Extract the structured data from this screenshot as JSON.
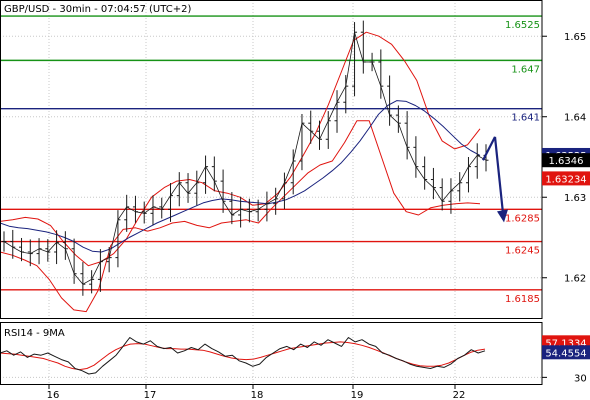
{
  "header": {
    "title": "GBP/USD - 30min - 07:04:57 (UTC+2)"
  },
  "colors": {
    "resistance": "#169216",
    "pivot": "#1a237e",
    "support": "#e0140f",
    "price": "#1a1a1a",
    "bollinger": "#e0140f",
    "moving_average": "#1a237e",
    "forecast_arrow": "#1a237e",
    "rsi_line": "#1a1a1a",
    "rsi_ma": "#e0140f",
    "grid": "#c8c8c8"
  },
  "chart_data": [
    {
      "type": "line",
      "title": "GBP/USD - 30min - 07:04:57 (UTC+2)",
      "x": [
        "16",
        "17",
        "18",
        "19",
        "22"
      ],
      "ylim": [
        1.615,
        1.6545
      ],
      "y_ticks": [
        "1.65",
        "1.64",
        "1.63",
        "1.62"
      ],
      "grid": true,
      "levels": [
        {
          "label": "1.6525",
          "value": 1.6525,
          "role": "resistance"
        },
        {
          "label": "1.647",
          "value": 1.647,
          "role": "resistance"
        },
        {
          "label": "1.641",
          "value": 1.641,
          "role": "pivot"
        },
        {
          "label": "1.6285",
          "value": 1.6285,
          "role": "support"
        },
        {
          "label": "1.6245",
          "value": 1.6245,
          "role": "support"
        },
        {
          "label": "1.6185",
          "value": 1.6185,
          "role": "support"
        }
      ],
      "badges": [
        {
          "label": "1.63525",
          "value": 1.63525,
          "color": "#1a237e"
        },
        {
          "label": "1.6346",
          "value": 1.6346,
          "color": "#000000"
        },
        {
          "label": "1.63234",
          "value": 1.63234,
          "color": "#e0140f"
        }
      ],
      "series": [
        {
          "values": [
            1.6245,
            1.6238,
            1.6232,
            1.623,
            1.6236,
            1.6232,
            1.6244,
            1.6236,
            1.6205,
            1.6192,
            1.6198,
            1.622,
            1.6225,
            1.6272,
            1.6288,
            1.6282,
            1.628,
            1.6288,
            1.6285,
            1.6302,
            1.6318,
            1.6305,
            1.6318,
            1.6338,
            1.632,
            1.6295,
            1.6278,
            1.6285,
            1.6282,
            1.6285,
            1.6292,
            1.6298,
            1.6318,
            1.6345,
            1.6392,
            1.6382,
            1.6372,
            1.6395,
            1.6418,
            1.6438,
            1.6505,
            1.6468,
            1.6468,
            1.6438,
            1.6402,
            1.6392,
            1.6362,
            1.6338,
            1.6322,
            1.6312,
            1.6295,
            1.6308,
            1.6318,
            1.6338,
            1.6352,
            1.6346
          ]
        },
        {
          "values": [
            1.6268,
            1.6264,
            1.6262,
            1.6261,
            1.6259,
            1.6257,
            1.6254,
            1.625,
            1.6245,
            1.6238,
            1.6233,
            1.6232,
            1.6236,
            1.6243,
            1.625,
            1.6256,
            1.6262,
            1.6268,
            1.6273,
            1.6278,
            1.6283,
            1.6288,
            1.6293,
            1.6296,
            1.6298,
            1.6297,
            1.6295,
            1.6294,
            1.6293,
            1.6292,
            1.6294,
            1.6297,
            1.6302,
            1.6308,
            1.6316,
            1.6324,
            1.6333,
            1.6343,
            1.6356,
            1.637,
            1.6386,
            1.6403,
            1.6414,
            1.642,
            1.6419,
            1.6414,
            1.6407,
            1.6398,
            1.6388,
            1.6377,
            1.6366,
            1.6358,
            1.6352
          ]
        },
        {
          "values": [
            1.627,
            1.6272,
            1.6275,
            1.6273,
            1.6265,
            1.6245,
            1.6228,
            1.6215,
            1.622,
            1.623,
            1.6248,
            1.6275,
            1.63,
            1.6312,
            1.632,
            1.6322,
            1.6318,
            1.6308,
            1.6305,
            1.63,
            1.629,
            1.6292,
            1.6305,
            1.6325,
            1.6352,
            1.638,
            1.6415,
            1.6455,
            1.6495,
            1.6505,
            1.65,
            1.649,
            1.647,
            1.6445,
            1.64,
            1.637,
            1.636,
            1.6365,
            1.6385
          ]
        },
        {
          "values": [
            1.6232,
            1.6228,
            1.6222,
            1.6215,
            1.6198,
            1.6175,
            1.616,
            1.6158,
            1.6185,
            1.624,
            1.626,
            1.6262,
            1.6258,
            1.6262,
            1.6268,
            1.627,
            1.6265,
            1.6262,
            1.6268,
            1.627,
            1.6272,
            1.6268,
            1.6285,
            1.63,
            1.6315,
            1.633,
            1.634,
            1.6345,
            1.6368,
            1.6395,
            1.6395,
            1.635,
            1.6305,
            1.6282,
            1.6278,
            1.6287,
            1.629,
            1.6292,
            1.6293,
            1.6292
          ]
        },
        {
          "values": [
            1.6346,
            1.6375
          ]
        },
        {
          "values": [
            1.6375,
            1.627
          ]
        }
      ]
    },
    {
      "type": "line",
      "title": "RSI14 - 9MA",
      "ylim": [
        24,
        80
      ],
      "y_ticks": [
        "30"
      ],
      "badges": [
        {
          "label": "57.1334",
          "value": 57.1334,
          "color": "#e0140f"
        },
        {
          "label": "54.4554",
          "value": 54.4554,
          "color": "#1a237e"
        }
      ],
      "series": [
        {
          "values": [
            52,
            54,
            50,
            53,
            48,
            51,
            50,
            52,
            49,
            46,
            44,
            38,
            36,
            33,
            34,
            40,
            45,
            50,
            58,
            66,
            62,
            60,
            63,
            58,
            56,
            57,
            52,
            54,
            57,
            55,
            60,
            56,
            53,
            49,
            50,
            45,
            43,
            40,
            42,
            48,
            52,
            56,
            58,
            55,
            60,
            57,
            62,
            59,
            64,
            61,
            58,
            66,
            62,
            64,
            60,
            58,
            52,
            50,
            47,
            45,
            42,
            40,
            39,
            38,
            40,
            39,
            42,
            47,
            50,
            55,
            52,
            54
          ]
        },
        {
          "values": [
            52,
            51.5,
            51,
            50,
            49,
            48,
            47,
            45,
            43,
            40,
            38,
            37,
            38,
            41,
            46,
            51,
            55,
            58,
            60,
            60.5,
            60,
            58.5,
            57,
            56,
            56,
            55.5,
            55.5,
            55,
            54.5,
            53,
            51,
            49,
            47.5,
            46.5,
            46,
            46.5,
            48,
            50,
            52,
            54,
            56,
            57,
            58,
            59,
            60,
            61,
            61.5,
            62,
            61.5,
            60.5,
            59,
            57,
            54.5,
            52,
            49,
            46.5,
            44,
            42,
            40.5,
            40,
            40,
            41,
            43,
            46,
            49.5,
            52.5,
            54.5,
            55.5
          ]
        }
      ]
    }
  ]
}
